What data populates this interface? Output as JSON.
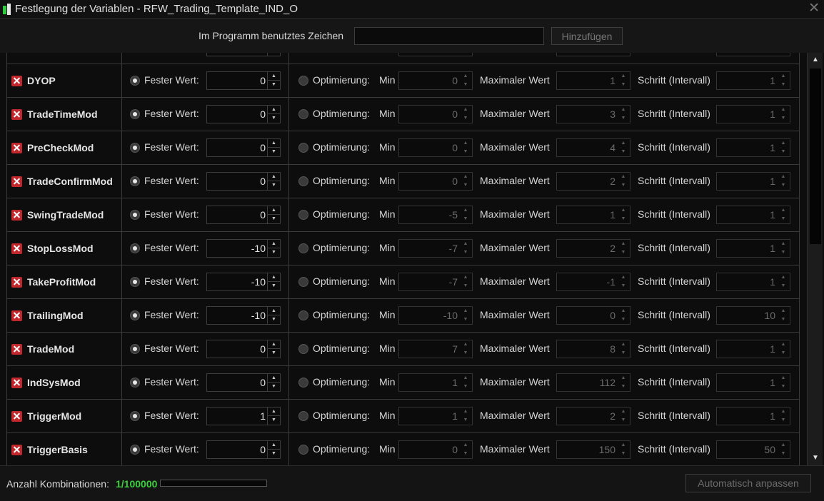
{
  "window": {
    "title": "Festlegung der Variablen - RFW_Trading_Template_IND_O"
  },
  "toolbar": {
    "symbol_label": "Im Programm benutztes Zeichen",
    "symbol_value": "",
    "add_button": "Hinzufügen"
  },
  "labels": {
    "fixed": "Fester Wert:",
    "optimize": "Optimierung:",
    "min": "Min",
    "max": "Maximaler Wert",
    "step": "Schritt (Intervall)"
  },
  "rows": [
    {
      "name": "",
      "fixed": "",
      "min": "",
      "max": "",
      "step": "",
      "partial": true
    },
    {
      "name": "DYOP",
      "fixed": "0",
      "min": "0",
      "max": "1",
      "step": "1"
    },
    {
      "name": "TradeTimeMod",
      "fixed": "0",
      "min": "0",
      "max": "3",
      "step": "1"
    },
    {
      "name": "PreCheckMod",
      "fixed": "0",
      "min": "0",
      "max": "4",
      "step": "1"
    },
    {
      "name": "TradeConfirmMod",
      "fixed": "0",
      "min": "0",
      "max": "2",
      "step": "1"
    },
    {
      "name": "SwingTradeMod",
      "fixed": "0",
      "min": "-5",
      "max": "1",
      "step": "1"
    },
    {
      "name": "StopLossMod",
      "fixed": "-10",
      "min": "-7",
      "max": "2",
      "step": "1"
    },
    {
      "name": "TakeProfitMod",
      "fixed": "-10",
      "min": "-7",
      "max": "-1",
      "step": "1"
    },
    {
      "name": "TrailingMod",
      "fixed": "-10",
      "min": "-10",
      "max": "0",
      "step": "10"
    },
    {
      "name": "TradeMod",
      "fixed": "0",
      "min": "7",
      "max": "8",
      "step": "1"
    },
    {
      "name": "IndSysMod",
      "fixed": "0",
      "min": "1",
      "max": "112",
      "step": "1"
    },
    {
      "name": "TriggerMod",
      "fixed": "1",
      "min": "1",
      "max": "2",
      "step": "1"
    },
    {
      "name": "TriggerBasis",
      "fixed": "0",
      "min": "0",
      "max": "150",
      "step": "50"
    }
  ],
  "footer": {
    "combinations_label": "Anzahl Kombinationen:",
    "combinations_value": "1/100000",
    "progress": 0.0,
    "auto_button": "Automatisch anpassen"
  },
  "icons": {
    "close": "close-icon",
    "checkbox": "checkbox-checked-icon",
    "scroll_up": "arrow-up-icon",
    "scroll_down": "arrow-down-icon"
  },
  "colors": {
    "accent_green": "#3dcf3d",
    "checkbox_red": "#c0282d",
    "background": "#0d0d0d"
  }
}
